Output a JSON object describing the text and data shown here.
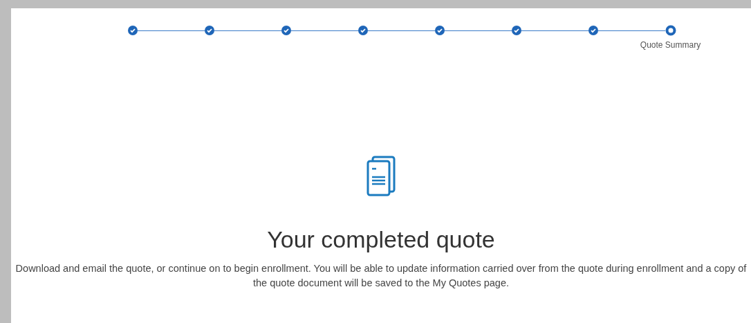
{
  "steps": [
    {
      "completed": true
    },
    {
      "completed": true
    },
    {
      "completed": true
    },
    {
      "completed": true
    },
    {
      "completed": true
    },
    {
      "completed": true
    },
    {
      "completed": true
    },
    {
      "completed": false,
      "label": "Quote Summary"
    }
  ],
  "title": "Your completed quote",
  "description": "Download and email the quote, or continue on to begin enrollment. You will be able to update information carried over from the quote during enrollment and a copy of the quote document will be saved to the My Quotes page."
}
